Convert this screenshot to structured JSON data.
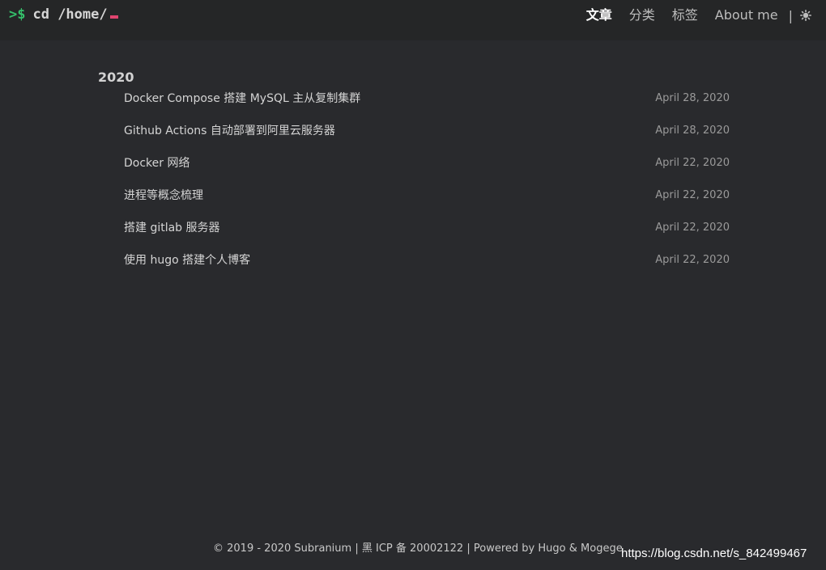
{
  "header": {
    "logo": {
      "prompt": ">$",
      "command": "cd /home/"
    },
    "nav": [
      {
        "label": "文章",
        "active": true
      },
      {
        "label": "分类",
        "active": false
      },
      {
        "label": "标签",
        "active": false
      },
      {
        "label": "About me",
        "active": false
      }
    ],
    "separator": "|",
    "theme_icon": "theme-toggle-icon"
  },
  "archive": {
    "year": "2020",
    "posts": [
      {
        "title": "Docker Compose 搭建 MySQL 主从复制集群",
        "date": "April 28, 2020"
      },
      {
        "title": "Github Actions 自动部署到阿里云服务器",
        "date": "April 28, 2020"
      },
      {
        "title": "Docker 网络",
        "date": "April 22, 2020"
      },
      {
        "title": "进程等概念梳理",
        "date": "April 22, 2020"
      },
      {
        "title": "搭建 gitlab 服务器",
        "date": "April 22, 2020"
      },
      {
        "title": "使用 hugo 搭建个人博客",
        "date": "April 22, 2020"
      }
    ]
  },
  "footer": {
    "copyright": "© 2019 - 2020 Subranium",
    "sep1": "|",
    "icp": "黑 ICP 备 20002122",
    "sep2": "|",
    "powered_prefix": "Powered by",
    "hugo": "Hugo",
    "amp": "&",
    "theme": "Mogege"
  },
  "watermark": "https://blog.csdn.net/s_842499467",
  "colors": {
    "background": "#292a2d",
    "header_bg": "#252627",
    "prompt": "#35c06b",
    "cursor": "#e0446f"
  }
}
